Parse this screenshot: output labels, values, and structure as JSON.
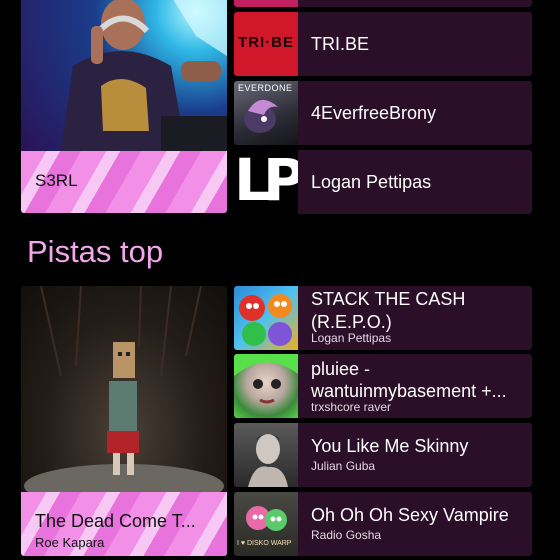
{
  "artists_featured": {
    "name": "S3RL"
  },
  "artists_list": [
    {
      "name": "TRI.BE",
      "thumb_label": "TRI·BE"
    },
    {
      "name": "4EverfreeBrony",
      "thumb_label": "EVERDONE"
    },
    {
      "name": "Logan Pettipas",
      "thumb_label": "LP"
    }
  ],
  "section": {
    "title": "Pistas top"
  },
  "track_featured": {
    "title": "The Dead Come T...",
    "artist": "Roe Kapara"
  },
  "tracks": [
    {
      "title_line1": "STACK THE CASH",
      "title_line2": "(R.E.P.O.)",
      "artist": "Logan Pettipas"
    },
    {
      "title_line1": "pluiee -",
      "title_line2": "wantuinmybasement +...",
      "artist": "trxshcore raver"
    },
    {
      "title": "You Like Me Skinny",
      "artist": "Julian Guba"
    },
    {
      "title": "Oh Oh Oh Sexy Vampire",
      "artist": "Radio Gosha",
      "thumb_label": "I ♥ DISKO WARP"
    }
  ],
  "colors": {
    "accent": "#f2a7ec",
    "row_bg": "#2b0f28",
    "band_pink": "#f28fe7"
  }
}
